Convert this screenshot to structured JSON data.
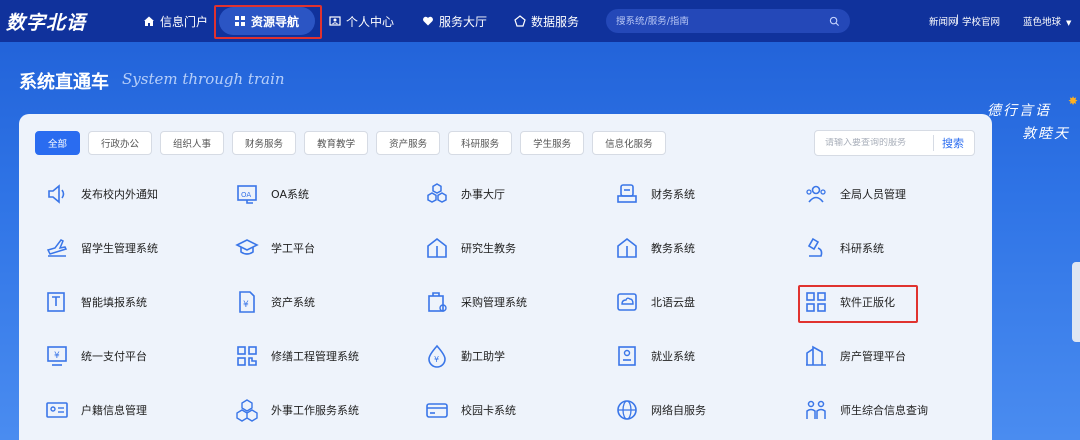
{
  "app": {
    "logo": "数字北语"
  },
  "nav": {
    "items": [
      {
        "label": "信息门户",
        "icon": "home-icon"
      },
      {
        "label": "资源导航",
        "icon": "grid-icon",
        "active": true
      },
      {
        "label": "个人中心",
        "icon": "person-card-icon"
      },
      {
        "label": "服务大厅",
        "icon": "heart-icon"
      },
      {
        "label": "数据服务",
        "icon": "data-icon"
      }
    ],
    "search_placeholder": "搜系统/服务/指南",
    "right_links": [
      "新闻网",
      "|",
      "学校官网"
    ],
    "theme": "蓝色地球"
  },
  "banner": {
    "title": "系统直通车",
    "subtitle": "System through train",
    "motto_line1": "德行言语",
    "motto_line2": "敦睦天"
  },
  "filters": [
    "全部",
    "行政办公",
    "组织人事",
    "财务服务",
    "教育教学",
    "资产服务",
    "科研服务",
    "学生服务",
    "信息化服务"
  ],
  "card_search": {
    "placeholder": "请输入要查询的服务",
    "button": "搜索"
  },
  "services": [
    [
      {
        "label": "发布校内外通知",
        "icon": "speaker-icon"
      },
      {
        "label": "OA系统",
        "icon": "oa-icon"
      },
      {
        "label": "办事大厅",
        "icon": "hexagons-icon"
      },
      {
        "label": "财务系统",
        "icon": "finance-icon"
      },
      {
        "label": "全局人员管理",
        "icon": "people-icon"
      }
    ],
    [
      {
        "label": "留学生管理系统",
        "icon": "plane-icon"
      },
      {
        "label": "学工平台",
        "icon": "graduation-cap-icon"
      },
      {
        "label": "研究生教务",
        "icon": "book-house-icon"
      },
      {
        "label": "教务系统",
        "icon": "book-house-icon"
      },
      {
        "label": "科研系统",
        "icon": "microscope-icon"
      }
    ],
    [
      {
        "label": "智能填报系统",
        "icon": "form-edit-icon"
      },
      {
        "label": "资产系统",
        "icon": "asset-doc-icon"
      },
      {
        "label": "采购管理系统",
        "icon": "purchase-icon"
      },
      {
        "label": "北语云盘",
        "icon": "cloud-disk-icon"
      },
      {
        "label": "软件正版化",
        "icon": "apps-grid-icon"
      }
    ],
    [
      {
        "label": "统一支付平台",
        "icon": "yen-screen-icon"
      },
      {
        "label": "修缮工程管理系统",
        "icon": "qr-grid-icon"
      },
      {
        "label": "勤工助学",
        "icon": "drop-yen-icon"
      },
      {
        "label": "就业系统",
        "icon": "job-doc-icon"
      },
      {
        "label": "房产管理平台",
        "icon": "building-icon"
      }
    ],
    [
      {
        "label": "户籍信息管理",
        "icon": "id-card-icon"
      },
      {
        "label": "外事工作服务系统",
        "icon": "cubes-icon"
      },
      {
        "label": "校园卡系统",
        "icon": "card-icon"
      },
      {
        "label": "网络自服务",
        "icon": "globe-icon"
      },
      {
        "label": "师生综合信息查询",
        "icon": "teacher-student-icon"
      }
    ]
  ],
  "colors": {
    "nav_bg": "#10329c",
    "accent": "#2a6cf0",
    "highlight": "#e0322f"
  }
}
